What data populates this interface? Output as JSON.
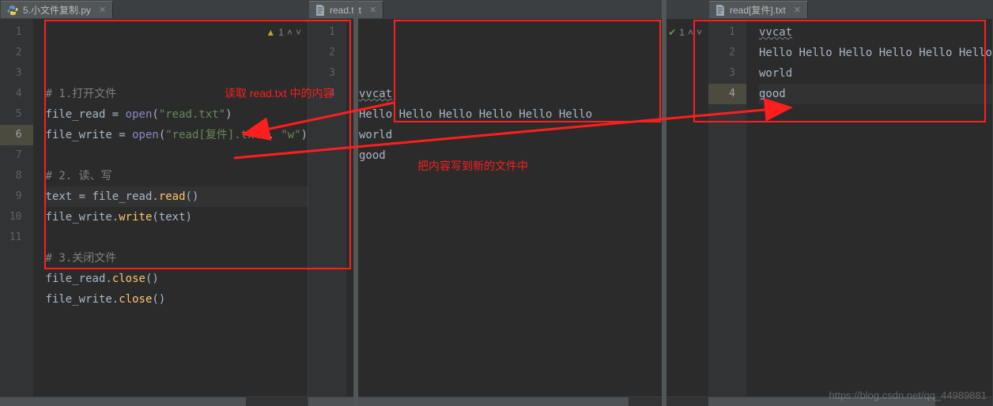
{
  "panels": [
    {
      "tab": {
        "label": "5.小文件复制.py",
        "icon": "python"
      },
      "status": {
        "kind": "warn",
        "count": "1"
      },
      "lines": [
        {
          "n": "1",
          "segs": [
            {
              "cls": "cm",
              "t": "# 1.打开文件"
            }
          ]
        },
        {
          "n": "2",
          "segs": [
            {
              "cls": "txt",
              "t": "file_read = "
            },
            {
              "cls": "fn",
              "t": "open"
            },
            {
              "cls": "txt",
              "t": "("
            },
            {
              "cls": "str",
              "t": "\"read.txt\""
            },
            {
              "cls": "txt",
              "t": ")"
            }
          ]
        },
        {
          "n": "3",
          "segs": [
            {
              "cls": "txt",
              "t": "file_write = "
            },
            {
              "cls": "fn",
              "t": "open"
            },
            {
              "cls": "txt",
              "t": "("
            },
            {
              "cls": "str",
              "t": "\"read[复件].txt\""
            },
            {
              "cls": "txt",
              "t": ", "
            },
            {
              "cls": "str",
              "t": "\"w\""
            },
            {
              "cls": "txt",
              "t": ")"
            }
          ]
        },
        {
          "n": "4",
          "segs": [
            {
              "cls": "txt",
              "t": ""
            }
          ]
        },
        {
          "n": "5",
          "segs": [
            {
              "cls": "cm",
              "t": "# 2. 读、写"
            }
          ]
        },
        {
          "n": "6",
          "active": true,
          "segs": [
            {
              "cls": "txt",
              "t": "text = file_read."
            },
            {
              "cls": "call",
              "t": "read"
            },
            {
              "cls": "txt",
              "t": "()"
            }
          ]
        },
        {
          "n": "7",
          "segs": [
            {
              "cls": "txt",
              "t": "file_write."
            },
            {
              "cls": "call",
              "t": "write"
            },
            {
              "cls": "txt",
              "t": "(text)"
            }
          ]
        },
        {
          "n": "8",
          "segs": [
            {
              "cls": "txt",
              "t": ""
            }
          ]
        },
        {
          "n": "9",
          "segs": [
            {
              "cls": "cm",
              "t": "# 3.关闭文件"
            }
          ]
        },
        {
          "n": "10",
          "segs": [
            {
              "cls": "txt",
              "t": "file_read."
            },
            {
              "cls": "call",
              "t": "close"
            },
            {
              "cls": "txt",
              "t": "()"
            }
          ]
        },
        {
          "n": "11",
          "segs": [
            {
              "cls": "txt",
              "t": "file_write."
            },
            {
              "cls": "call",
              "t": "close"
            },
            {
              "cls": "txt",
              "t": "()"
            }
          ]
        }
      ]
    },
    {
      "tab": {
        "label": "read.txt",
        "icon": "text"
      },
      "status": {
        "kind": "ok",
        "count": "1"
      },
      "lines": [
        {
          "n": "1",
          "segs": [
            {
              "cls": "txt wavy",
              "t": "vvcat"
            }
          ]
        },
        {
          "n": "2",
          "segs": [
            {
              "cls": "txt",
              "t": "Hello Hello Hello Hello Hello Hello"
            }
          ]
        },
        {
          "n": "3",
          "segs": [
            {
              "cls": "txt",
              "t": "world"
            }
          ]
        },
        {
          "n": "4",
          "segs": [
            {
              "cls": "txt",
              "t": "good"
            }
          ]
        }
      ]
    },
    {
      "tab": {
        "label": "read[复件].txt",
        "icon": "text"
      },
      "status": null,
      "lines": [
        {
          "n": "1",
          "segs": [
            {
              "cls": "txt wavy",
              "t": "vvcat"
            }
          ]
        },
        {
          "n": "2",
          "segs": [
            {
              "cls": "txt",
              "t": "Hello Hello Hello Hello Hello Hello"
            }
          ]
        },
        {
          "n": "3",
          "segs": [
            {
              "cls": "txt",
              "t": "world"
            }
          ]
        },
        {
          "n": "4",
          "active": true,
          "segs": [
            {
              "cls": "txt",
              "t": "good"
            }
          ]
        }
      ]
    }
  ],
  "annotations": {
    "text1": "读取 read.txt 中的内容",
    "text2": "把内容写到新的文件中"
  },
  "watermark": "https://blog.csdn.net/qq_44989881"
}
